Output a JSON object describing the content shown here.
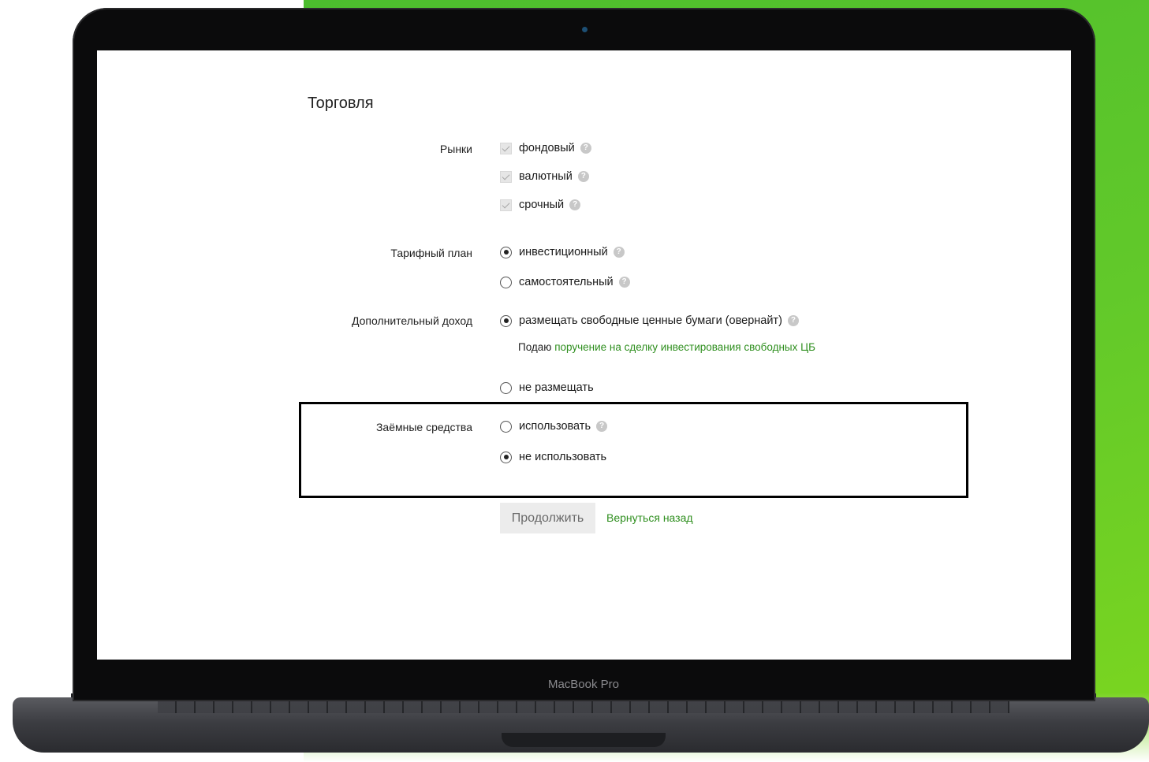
{
  "device": {
    "brand_label": "MacBook Pro"
  },
  "form": {
    "title": "Торговля",
    "markets": {
      "label": "Рынки",
      "options": [
        "фондовый",
        "валютный",
        "срочный"
      ]
    },
    "tariff": {
      "label": "Тарифный план",
      "options": [
        "инвестиционный",
        "самостоятельный"
      ],
      "selected": "инвестиционный"
    },
    "extra_income": {
      "label": "Дополнительный доход",
      "options": [
        "размещать свободные ценные бумаги (овернайт)",
        "не размещать"
      ],
      "selected": "размещать свободные ценные бумаги (овернайт)",
      "note_prefix": "Подаю ",
      "note_link": "поручение на сделку инвестирования свободных ЦБ"
    },
    "borrowed": {
      "label": "Заёмные средства",
      "options": [
        "использовать",
        "не использовать"
      ],
      "selected": "не использовать"
    },
    "continue_label": "Продолжить",
    "back_label": "Вернуться назад",
    "help_glyph": "?"
  },
  "colors": {
    "accent_green": "#2f8f1f",
    "background_green": "#5cc42c"
  }
}
